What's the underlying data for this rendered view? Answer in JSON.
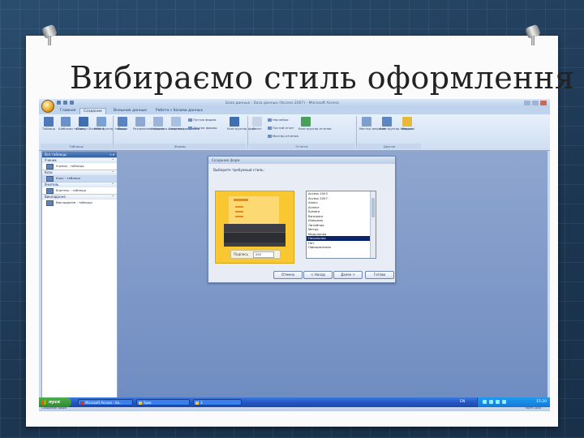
{
  "slide": {
    "title": "Вибираємо стиль оформлення"
  },
  "window": {
    "title": "База данных : база данных (Access 2007) - Microsoft Access"
  },
  "ribbon": {
    "tabs": [
      "Главная",
      "Создание",
      "Внешние данные",
      "Работа с базами данных"
    ],
    "active_tab": "Создание",
    "groups": [
      {
        "label": "Таблицы",
        "buttons": [
          "Таблица",
          "Шаблоны таблиц",
          "Списки SharePoint",
          "Конструктор таблиц"
        ]
      },
      {
        "label": "Формы",
        "buttons": [
          "Форма",
          "Разделенная форма",
          "Несколько элементов",
          "Сводная диаграмма",
          "Пустая форма",
          "Другие формы",
          "Конструктор форм"
        ]
      },
      {
        "label": "Отчеты",
        "buttons": [
          "Отчет",
          "Наклейки",
          "Пустой отчет",
          "Мастер отчетов",
          "Конструктор отчетов"
        ]
      },
      {
        "label": "Другие",
        "buttons": [
          "Мастер запросов",
          "Конструктор запросов",
          "Макрос"
        ]
      }
    ]
  },
  "nav": {
    "header": "Все таблицы",
    "groups": [
      {
        "name": "Ученик",
        "items": [
          "Ученик : таблица"
        ]
      },
      {
        "name": "Клас",
        "items": [
          "Клас : таблица"
        ]
      },
      {
        "name": "Вчитель",
        "items": [
          "Вчитель : таблица"
        ]
      },
      {
        "name": "Викладання",
        "items": [
          "Викладання : таблица"
        ]
      }
    ]
  },
  "status": {
    "left": "Создание форм",
    "right": "Num Lock"
  },
  "wizard": {
    "title": "Создание форм",
    "prompt": "Выберите требуемый стиль:",
    "preview_label": "Подпись",
    "preview_value": "ххх",
    "styles": [
      "Access 2003",
      "Access 2007",
      "Апекс",
      "Аспект",
      "Бумага",
      "Витражи",
      "Изящная",
      "Литейная",
      "Метро",
      "Модульная",
      "Начальная",
      "Нет",
      "Официальная"
    ],
    "selected_style": "Начальная",
    "buttons": {
      "cancel": "Отмена",
      "back": "< Назад",
      "next": "Далее >",
      "finish": "Готово"
    }
  },
  "taskbar": {
    "start": "пуск",
    "tasks": [
      "Microsoft Access - ба...",
      "Урок",
      "3"
    ],
    "lang": "EN",
    "clock": "15:20"
  }
}
